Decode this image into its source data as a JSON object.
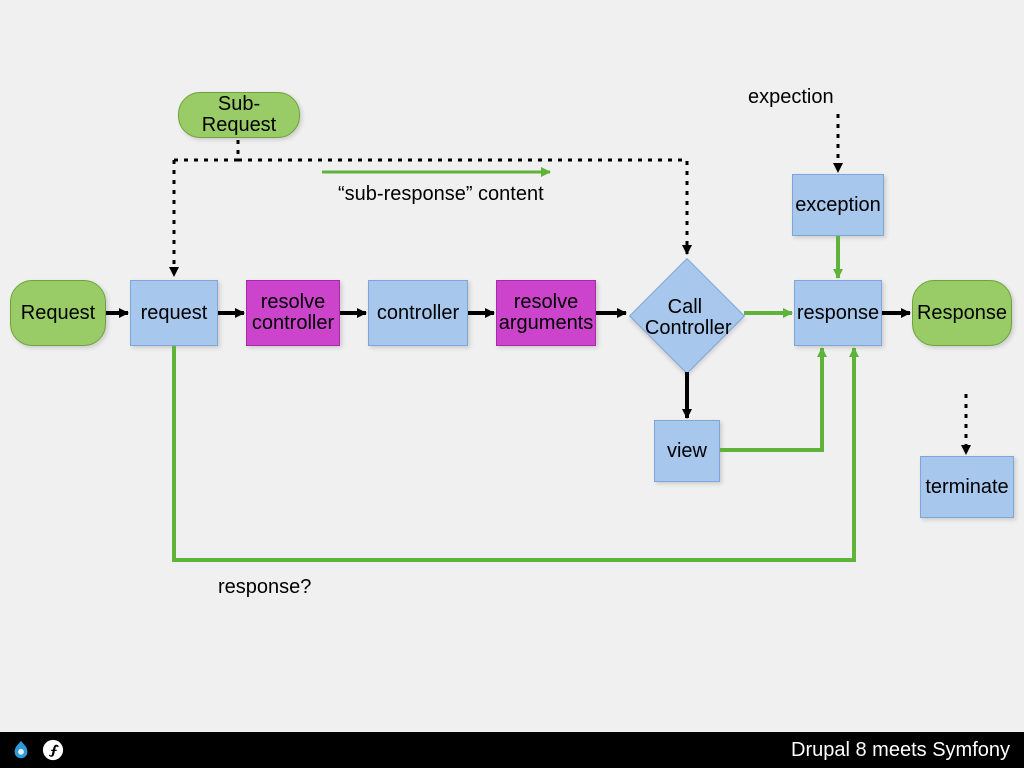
{
  "nodes": {
    "sub_request": "Sub-Request",
    "request_pill": "Request",
    "request_box": "request",
    "resolve_controller": "resolve\ncontroller",
    "controller": "controller",
    "resolve_arguments": "resolve\narguments",
    "call_controller": "Call\nController",
    "exception": "exception",
    "response_box": "response",
    "response_pill": "Response",
    "view": "view",
    "terminate": "terminate"
  },
  "labels": {
    "sub_response": "“sub-response” content",
    "expection": "expection",
    "response_q": "response?"
  },
  "footer": {
    "title": "Drupal 8 meets Symfony"
  },
  "colors": {
    "green_arrow": "#5fb23a",
    "black": "#000000"
  }
}
